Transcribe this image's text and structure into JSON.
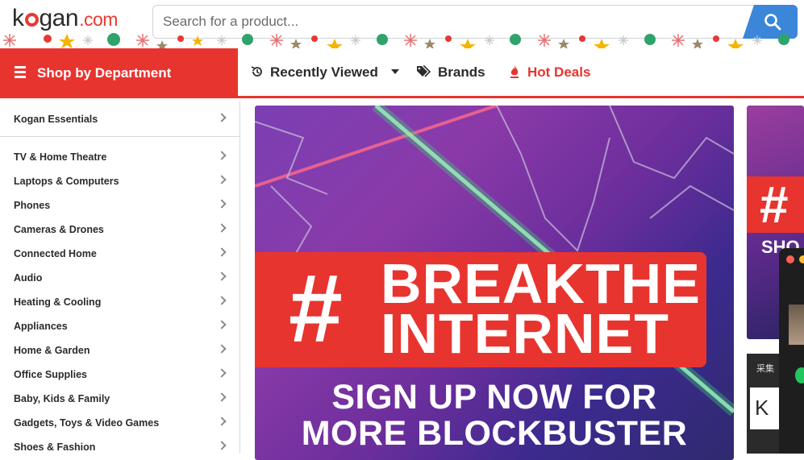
{
  "brand": {
    "logo_main": "kogan",
    "logo_suffix": ".com"
  },
  "search": {
    "placeholder": "Search for a product..."
  },
  "nav": {
    "department_label": "Shop by Department",
    "recently_viewed": "Recently Viewed",
    "brands": "Brands",
    "hot_deals": "Hot Deals"
  },
  "sidebar": {
    "items": [
      "Kogan Essentials",
      "TV & Home Theatre",
      "Laptops & Computers",
      "Phones",
      "Cameras & Drones",
      "Connected Home",
      "Audio",
      "Heating & Cooling",
      "Appliances",
      "Home & Garden",
      "Office Supplies",
      "Baby, Kids & Family",
      "Gadgets, Toys & Video Games",
      "Shoes & Fashion"
    ]
  },
  "banner": {
    "hash": "#",
    "line1": "BREAKTHE",
    "line2": "INTERNET",
    "sub1": "SIGN UP NOW FOR",
    "sub2": "MORE BLOCKBUSTER"
  },
  "banner2": {
    "hash": "#",
    "text": "SHO"
  },
  "panel3": {
    "label": "采集",
    "k": "K"
  },
  "colors": {
    "accent": "#e8342f",
    "search_button": "#3b86d8"
  },
  "icons": [
    "search-icon",
    "menu-icon",
    "history-icon",
    "caret-down-icon",
    "tags-icon",
    "flame-icon",
    "chevron-right-icon"
  ]
}
